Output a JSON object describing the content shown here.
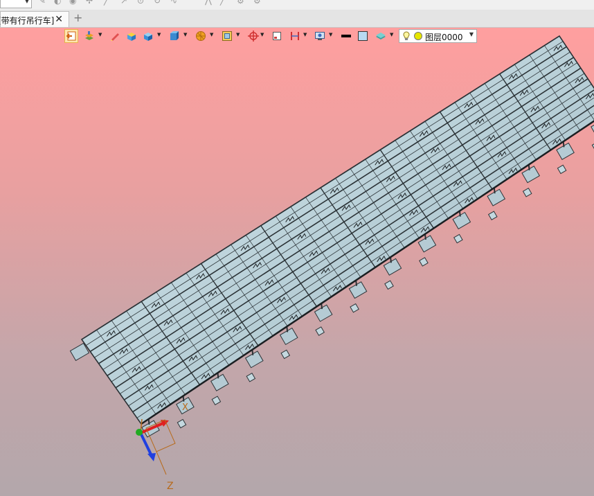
{
  "window": {
    "document_tab": "[带有行吊行车]",
    "close_glyph": "✕",
    "new_tab_glyph": "+"
  },
  "toolbar": {
    "layer_name": "图层0000",
    "icons": [
      "exit-sketch-icon",
      "layers-icon",
      "pencil-icon",
      "box-yellow-icon",
      "box-blue-icon",
      "cube-view-icon",
      "render-ball-icon",
      "frame-icon",
      "snap-target-icon",
      "doc-icon",
      "dimension-icon",
      "display-settings-icon",
      "line-color-icon",
      "fill-color-icon",
      "plane-icon",
      "lightbulb-icon",
      "layer-color-icon"
    ]
  },
  "colors": {
    "viewport_top": "#ff9f9f",
    "viewport_bottom": "#b3a7ab",
    "model_face": "#b9d0d8",
    "model_line": "#2b3236",
    "axis_x": "#e02020",
    "axis_y": "#22aa22",
    "axis_z": "#2040e0",
    "axis_label": "#b86a1a"
  },
  "model": {
    "rows": 14,
    "cols": 32,
    "columns": 14
  },
  "axes": {
    "x_label": "X",
    "z_label": "Z"
  }
}
